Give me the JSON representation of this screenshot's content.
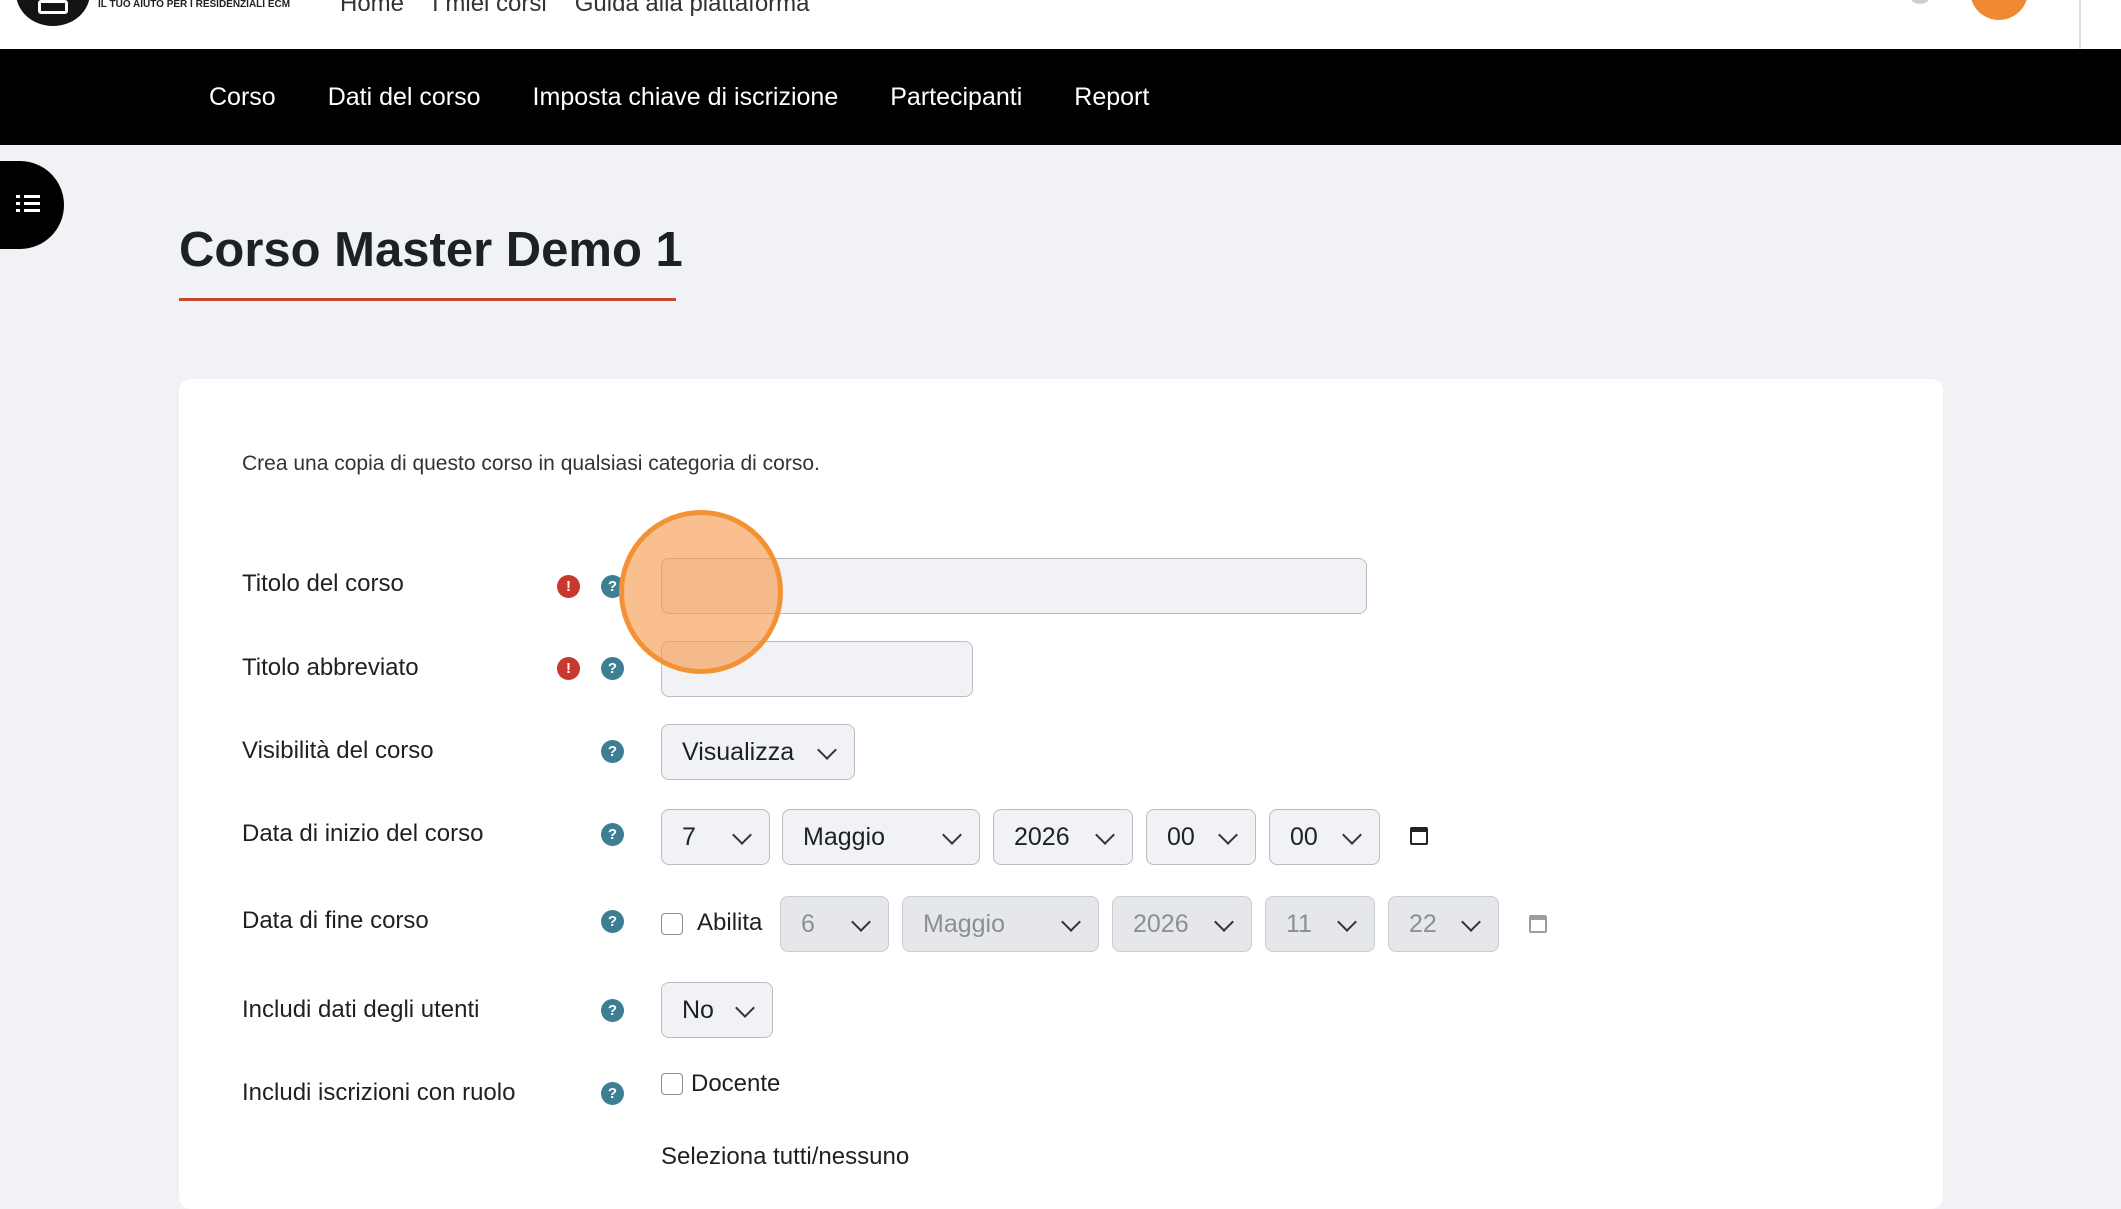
{
  "header": {
    "logo_tagline": "IL TUO AIUTO PER I RESIDENZIALI ECM",
    "nav": [
      "Home",
      "I miei corsi",
      "Guida alla piattaforma"
    ]
  },
  "secondary_nav": {
    "items": [
      "Corso",
      "Dati del corso",
      "Imposta chiave di iscrizione",
      "Partecipanti",
      "Report"
    ]
  },
  "page": {
    "title": "Corso Master Demo 1"
  },
  "form": {
    "intro": "Crea una copia di questo corso in qualsiasi categoria di corso.",
    "fullname": {
      "label": "Titolo del corso",
      "required_icon": "!",
      "help_icon": "?",
      "value": ""
    },
    "shortname": {
      "label": "Titolo abbreviato",
      "required_icon": "!",
      "help_icon": "?",
      "value": ""
    },
    "visibility": {
      "label": "Visibilità del corso",
      "help_icon": "?",
      "value": "Visualizza"
    },
    "startdate": {
      "label": "Data di inizio del corso",
      "help_icon": "?",
      "day": "7",
      "month": "Maggio",
      "year": "2026",
      "hour": "00",
      "minute": "00"
    },
    "enddate": {
      "label": "Data di fine corso",
      "help_icon": "?",
      "enable_label": "Abilita",
      "day": "6",
      "month": "Maggio",
      "year": "2026",
      "hour": "11",
      "minute": "22"
    },
    "userdata": {
      "label": "Includi dati degli utenti",
      "help_icon": "?",
      "value": "No"
    },
    "roles": {
      "label": "Includi iscrizioni con ruolo",
      "help_icon": "?",
      "option": "Docente",
      "select_all": "Seleziona tutti/nessuno"
    }
  },
  "colors": {
    "accent_underline": "#c8462b",
    "required": "#c8382c",
    "help": "#3d7e92",
    "highlight": "#f39235"
  }
}
